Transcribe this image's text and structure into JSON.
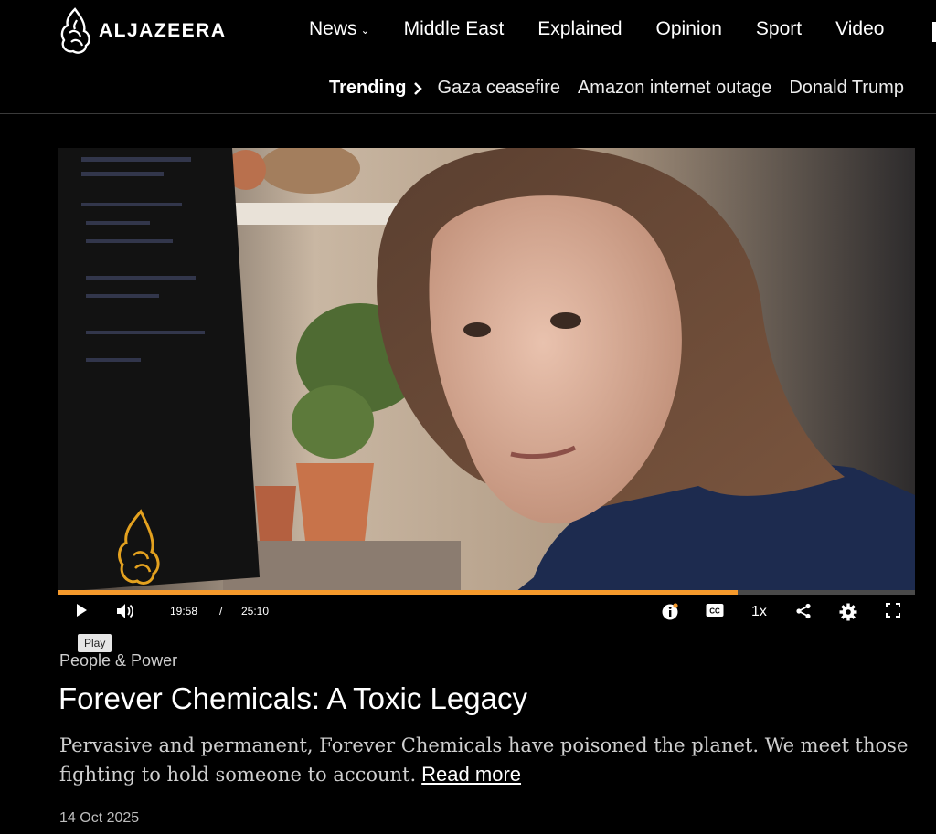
{
  "header": {
    "brand": "ALJAZEERA",
    "nav": [
      {
        "label": "News",
        "has_dropdown": true
      },
      {
        "label": "Middle East"
      },
      {
        "label": "Explained"
      },
      {
        "label": "Opinion"
      },
      {
        "label": "Sport"
      },
      {
        "label": "Video"
      }
    ],
    "trending_label": "Trending",
    "trending": [
      "Gaza ceasefire",
      "Amazon internet outage",
      "Donald Trump"
    ]
  },
  "player": {
    "current_time": "19:58",
    "separator": "/",
    "duration": "25:10",
    "progress_fraction": 0.793,
    "speed": "1x",
    "play_tooltip": "Play",
    "icons": [
      "play-icon",
      "volume-icon",
      "info-icon",
      "captions-icon",
      "share-icon",
      "settings-icon",
      "fullscreen-icon"
    ],
    "accent_color": "#f59a2c"
  },
  "article": {
    "category": "People & Power",
    "title": "Forever Chemicals: A Toxic Legacy",
    "description": "Pervasive and permanent, Forever Chemicals have poisoned the planet. We meet those fighting to hold someone to account.",
    "read_more": "Read more",
    "date": "14 Oct 2025"
  }
}
